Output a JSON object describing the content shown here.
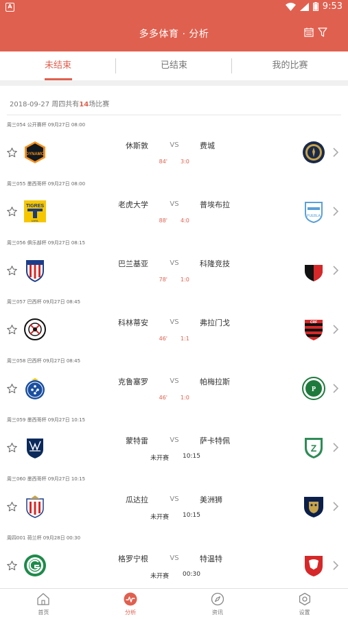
{
  "status_bar": {
    "time": "9:53"
  },
  "app_bar": {
    "title": "多多体育 · 分析",
    "calendar_icon": "calendar-icon",
    "filter_icon": "filter-icon"
  },
  "tabs": [
    {
      "label": "未结束",
      "active": true
    },
    {
      "label": "已结束",
      "active": false
    },
    {
      "label": "我的比赛",
      "active": false
    }
  ],
  "date_header": {
    "prefix": "2018-09-27 周四共有",
    "count": "14",
    "suffix": "场比赛"
  },
  "matches": [
    {
      "meta": "周三054 公开赛杯 09月27日 08:00",
      "home": "休斯敦",
      "away": "费城",
      "vs": "VS",
      "minute": "84'",
      "score": "3:0",
      "home_crest": "dynamo-crest",
      "away_crest": "union-crest"
    },
    {
      "meta": "周三055 墨西哥杯 09月27日 08:00",
      "home": "老虎大学",
      "away": "普埃布拉",
      "vs": "VS",
      "minute": "88'",
      "score": "4:0",
      "home_crest": "tigres-crest",
      "away_crest": "puebla-crest"
    },
    {
      "meta": "周三056 俱乐部杯 09月27日 08:15",
      "home": "巴兰基亚",
      "away": "科隆竞技",
      "vs": "VS",
      "minute": "78'",
      "score": "1:0",
      "home_crest": "junior-crest",
      "away_crest": "colon-crest"
    },
    {
      "meta": "周三057 巴西杯 09月27日 08:45",
      "home": "科林蒂安",
      "away": "弗拉门戈",
      "vs": "VS",
      "minute": "46'",
      "score": "1:1",
      "home_crest": "corinthians-crest",
      "away_crest": "flamengo-crest"
    },
    {
      "meta": "周三058 巴西杯 09月27日 08:45",
      "home": "克鲁塞罗",
      "away": "帕梅拉斯",
      "vs": "VS",
      "minute": "46'",
      "score": "1:0",
      "home_crest": "cruzeiro-crest",
      "away_crest": "palmeiras-crest"
    },
    {
      "meta": "周三059 墨西哥杯 09月27日 10:15",
      "home": "蒙特雷",
      "away": "萨卡特佩",
      "vs": "VS",
      "status": "未开赛",
      "time": "10:15",
      "home_crest": "monterrey-crest",
      "away_crest": "zacatepec-crest"
    },
    {
      "meta": "周三060 墨西哥杯 09月27日 10:15",
      "home": "瓜达拉",
      "away": "美洲狮",
      "vs": "VS",
      "status": "未开赛",
      "time": "10:15",
      "home_crest": "guadalajara-crest",
      "away_crest": "pumas-crest"
    },
    {
      "meta": "周四001 荷兰杯 09月28日 00:30",
      "home": "格罗宁根",
      "away": "特温特",
      "vs": "VS",
      "status": "未开赛",
      "time": "00:30",
      "home_crest": "groningen-crest",
      "away_crest": "twente-crest"
    }
  ],
  "colors": {
    "accent": "#e0604f",
    "text": "#333333",
    "muted": "#777777"
  },
  "bottom_nav": [
    {
      "label": "首页",
      "icon": "home-icon",
      "active": false
    },
    {
      "label": "分析",
      "icon": "analysis-icon",
      "active": true
    },
    {
      "label": "资讯",
      "icon": "compass-icon",
      "active": false
    },
    {
      "label": "设置",
      "icon": "settings-icon",
      "active": false
    }
  ]
}
